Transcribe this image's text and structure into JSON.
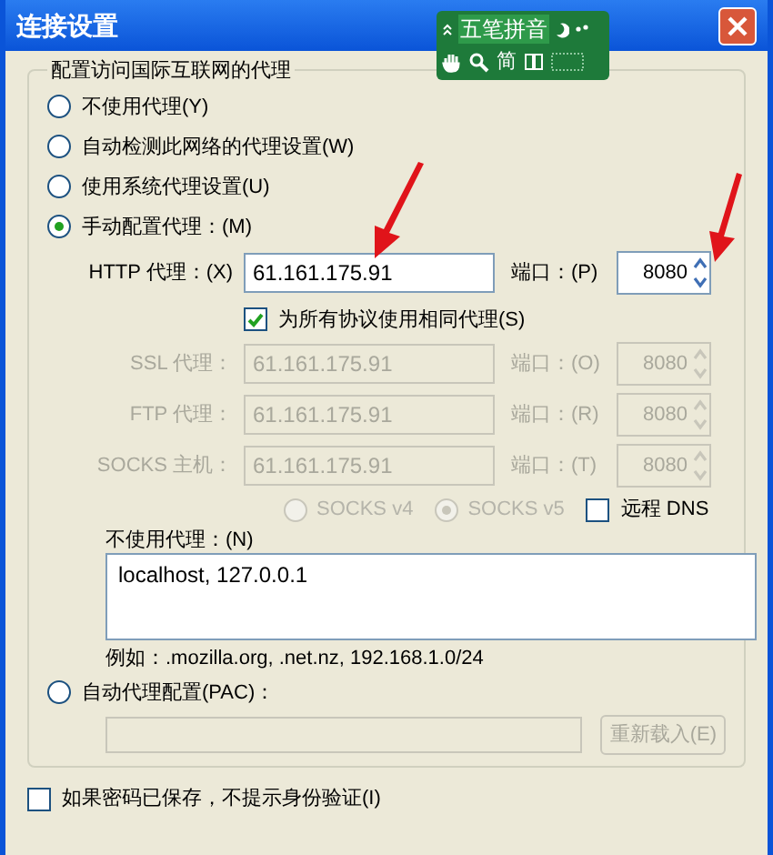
{
  "window": {
    "title": "连接设置"
  },
  "ime_bar": {
    "mode": "五笔拼音",
    "charset": "简"
  },
  "group": {
    "title": "配置访问国际互联网的代理",
    "options": [
      {
        "label": "不使用代理(Y)",
        "selected": false
      },
      {
        "label": "自动检测此网络的代理设置(W)",
        "selected": false
      },
      {
        "label": "使用系统代理设置(U)",
        "selected": false
      },
      {
        "label": "手动配置代理：(M)",
        "selected": true
      }
    ],
    "proxies": [
      {
        "label": "HTTP 代理：(X)",
        "value": "61.161.175.91",
        "port_label": "端口：(P)",
        "port": "8080",
        "disabled": false
      },
      {
        "label": "SSL 代理：",
        "value": "61.161.175.91",
        "port_label": "端口：(O)",
        "port": "8080",
        "disabled": true
      },
      {
        "label": "FTP 代理：",
        "value": "61.161.175.91",
        "port_label": "端口：(R)",
        "port": "8080",
        "disabled": true
      },
      {
        "label": "SOCKS 主机：",
        "value": "61.161.175.91",
        "port_label": "端口：(T)",
        "port": "8080",
        "disabled": true
      }
    ],
    "same_proxy": {
      "label": "为所有协议使用相同代理(S)",
      "checked": true
    },
    "socks_versions": [
      {
        "label": "SOCKS v4",
        "selected": false,
        "disabled": true
      },
      {
        "label": "SOCKS v5",
        "selected": true,
        "disabled": true
      }
    ],
    "remote_dns": {
      "label": "远程 DNS",
      "checked": false
    },
    "no_proxy": {
      "label": "不使用代理：(N)",
      "value": "localhost, 127.0.0.1",
      "example": "例如：.mozilla.org, .net.nz, 192.168.1.0/24"
    },
    "pac": {
      "label": "自动代理配置(PAC)：",
      "selected": false,
      "reload": "重新载入(E)",
      "reload_disabled": true
    }
  },
  "auth_checkbox": {
    "label": "如果密码已保存，不提示身份验证(I)",
    "checked": false
  }
}
